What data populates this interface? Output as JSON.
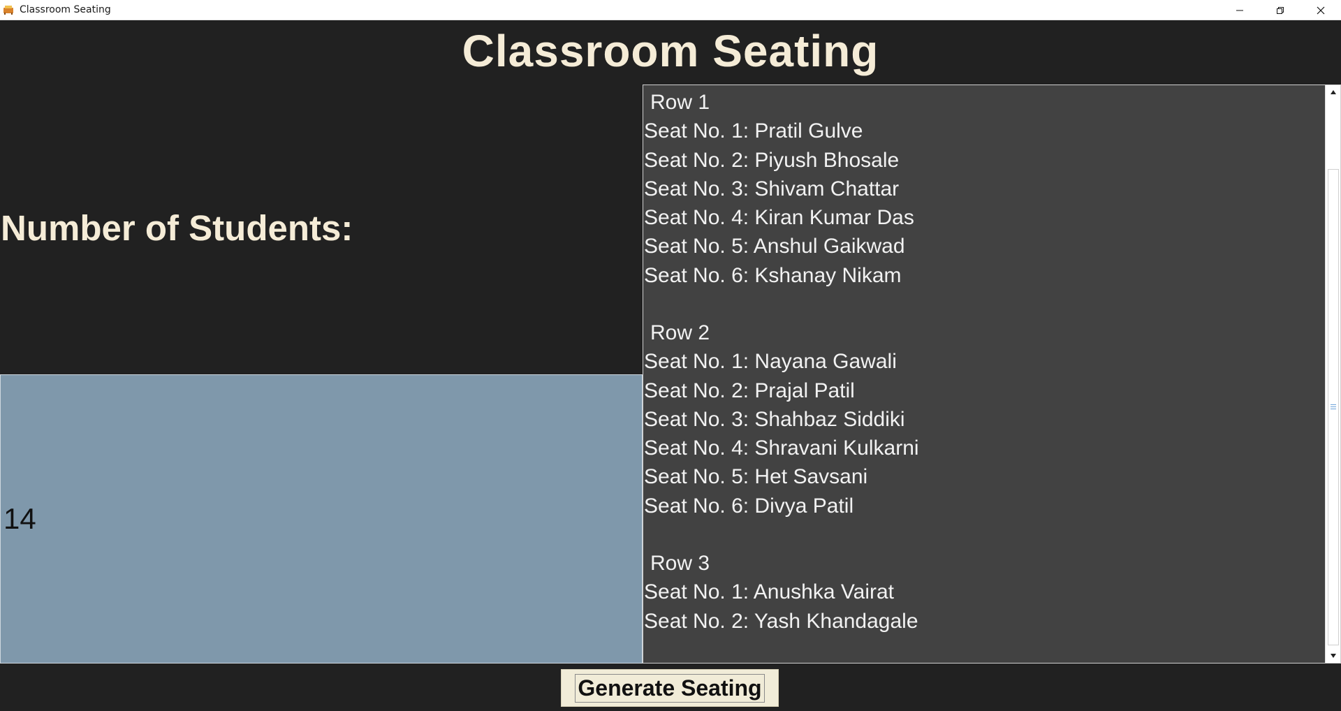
{
  "window": {
    "title": "Classroom Seating",
    "controls": [
      "minimize-icon",
      "restore-icon",
      "close-icon"
    ]
  },
  "app": {
    "heading": "Classroom Seating",
    "students_label": "Number of Students:",
    "students_value": "14",
    "generate_button": "Generate Seating"
  },
  "seating": {
    "rows": [
      {
        "label": "Row 1",
        "seats": [
          "Seat No. 1: Pratil Gulve",
          "Seat No. 2: Piyush Bhosale",
          "Seat No. 3: Shivam Chattar",
          "Seat No. 4: Kiran Kumar Das",
          "Seat No. 5: Anshul Gaikwad",
          "Seat No. 6: Kshanay Nikam"
        ]
      },
      {
        "label": "Row 2",
        "seats": [
          "Seat No. 1: Nayana Gawali",
          "Seat No. 2: Prajal Patil",
          "Seat No. 3: Shahbaz Siddiki",
          "Seat No. 4: Shravani Kulkarni",
          "Seat No. 5: Het Savsani",
          "Seat No. 6: Divya Patil"
        ]
      },
      {
        "label": "Row 3",
        "seats": [
          "Seat No. 1: Anushka Vairat",
          "Seat No. 2: Yash Khandagale"
        ]
      }
    ]
  },
  "colors": {
    "background": "#212121",
    "heading": "#f5ecd7",
    "input_bg": "#7f98ab",
    "list_bg": "#424242",
    "button_bg": "#f1ecd8"
  }
}
